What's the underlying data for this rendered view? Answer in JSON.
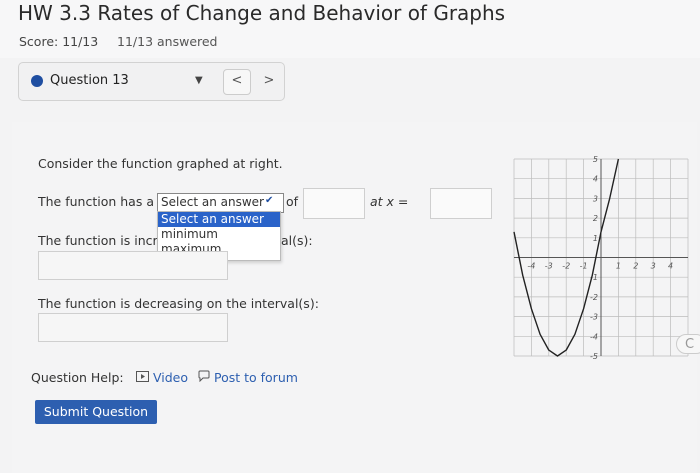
{
  "header": {
    "title": "HW 3.3 Rates of Change and Behavior of Graphs",
    "score": "Score: 11/13",
    "answered": "11/13 answered"
  },
  "question_nav": {
    "label": "Question 13",
    "prev": "<",
    "next": ">",
    "dot_color": "#1f4ea1"
  },
  "question": {
    "intro": "Consider the function graphed at right.",
    "line1_prefix": "The function has a",
    "select_value": "Select an answer",
    "line1_of": "of",
    "line1_at": "at x =",
    "dropdown_options": [
      "Select an answer",
      "minimum",
      "maximum"
    ],
    "line2_prefix": "The function is incr",
    "line2_suffix": "al(s):",
    "line3": "The function is decreasing on the interval(s):"
  },
  "help": {
    "label": "Question Help:",
    "video": "Video",
    "forum": "Post to forum"
  },
  "submit_label": "Submit Question",
  "corner_button": "C",
  "chart_data": {
    "type": "line",
    "xlim": [
      -5,
      5
    ],
    "ylim": [
      -5,
      5
    ],
    "grid": true,
    "x_tick_labels": [
      "-4",
      "-3",
      "-2",
      "-1",
      "1",
      "2",
      "3",
      "4"
    ],
    "y_tick_labels": [
      "5",
      "4",
      "3",
      "2",
      "1",
      "-1",
      "-2",
      "-3",
      "-4",
      "-5"
    ],
    "x": [
      -5,
      -4.5,
      -4,
      -3.5,
      -3,
      -2.5,
      -2,
      -1.5,
      -1,
      -0.5,
      0,
      0.5,
      1
    ],
    "y": [
      1.3,
      -0.9,
      -2.6,
      -3.9,
      -4.7,
      -5.0,
      -4.7,
      -3.9,
      -2.6,
      -0.9,
      1.3,
      3.0,
      5.0
    ],
    "line_color": "#222222"
  }
}
